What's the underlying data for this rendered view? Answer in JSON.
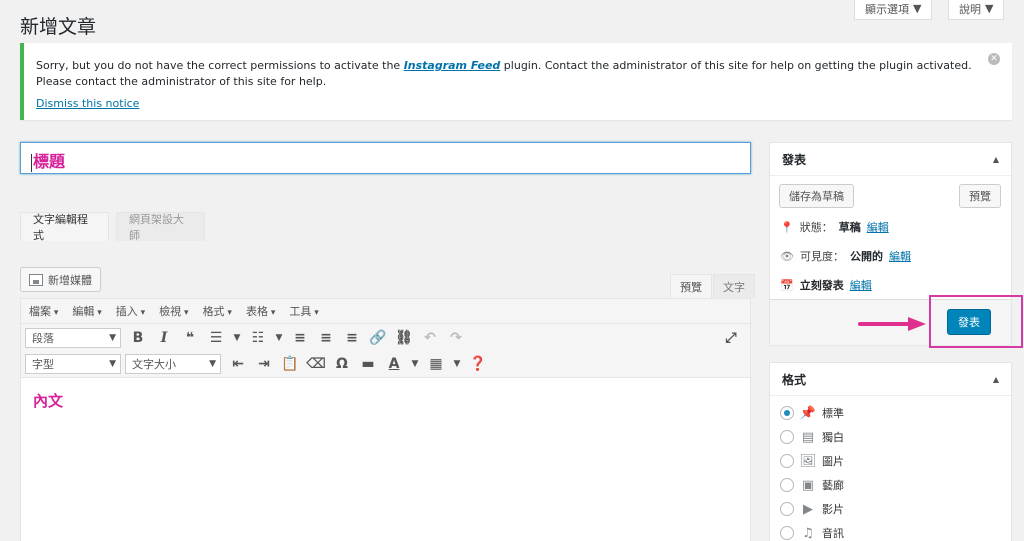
{
  "header": {
    "screen_options": "顯示選項",
    "help": "說明"
  },
  "page_title": "新增文章",
  "notice": {
    "text_before": "Sorry, but you do not have the correct permissions to activate the ",
    "plugin_name": "Instagram Feed",
    "text_after": " plugin. Contact the administrator of this site for help on getting the plugin activated.",
    "line2": "Please contact the administrator of this site for help.",
    "dismiss": "Dismiss this notice"
  },
  "title_field": {
    "value": "標題"
  },
  "editor_tabs": [
    "文字編輯程式",
    "網頁架設大師"
  ],
  "add_media": "新增媒體",
  "mode_tabs": {
    "visual": "預覽",
    "text": "文字"
  },
  "menubar": [
    "檔案",
    "編輯",
    "插入",
    "檢視",
    "格式",
    "表格",
    "工具"
  ],
  "format_select": "段落",
  "font_select": "字型",
  "size_select": "文字大小",
  "content": "內文",
  "publish": {
    "title": "發表",
    "save_draft": "儲存為草稿",
    "preview": "預覽",
    "status_label": "狀態：",
    "status_value": "草稿",
    "visibility_label": "可見度：",
    "visibility_value": "公開的",
    "schedule": "立刻發表",
    "edit": "編輯",
    "publish_button": "發表"
  },
  "formats": {
    "title": "格式",
    "items": [
      "標準",
      "獨白",
      "圖片",
      "藝廊",
      "影片",
      "音訊"
    ]
  },
  "colors": {
    "accent": "#0085ba",
    "highlight": "#d63aa6",
    "notice_border": "#46b450"
  }
}
